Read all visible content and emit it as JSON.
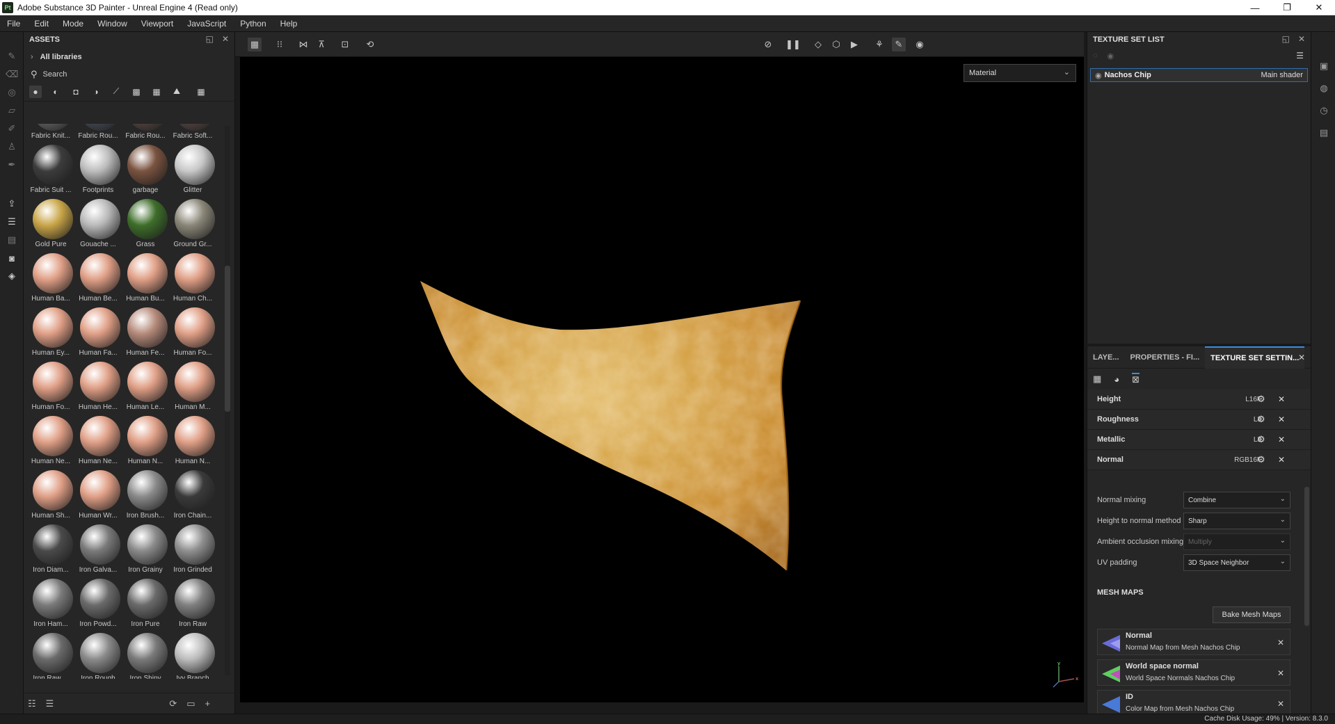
{
  "window": {
    "title": "Adobe Substance 3D Painter - Unreal Engine 4 (Read only)",
    "app_badge": "Pt",
    "minimize": "—",
    "maximize": "❐",
    "close": "✕"
  },
  "menu": [
    "File",
    "Edit",
    "Mode",
    "Window",
    "Viewport",
    "JavaScript",
    "Python",
    "Help"
  ],
  "assets": {
    "title": "ASSETS",
    "library": "All libraries",
    "search_placeholder": "Search",
    "items": [
      {
        "label": "Fabric Knit...",
        "color": "#6a6a6a"
      },
      {
        "label": "Fabric Rou...",
        "color": "#4a4f5a"
      },
      {
        "label": "Fabric Rou...",
        "color": "#5a4a45"
      },
      {
        "label": "Fabric Soft...",
        "color": "#5a4a48"
      },
      {
        "label": "Fabric Suit ...",
        "color": "#3c3c3c"
      },
      {
        "label": "Footprints",
        "color": "#bdbdbd"
      },
      {
        "label": "garbage",
        "color": "#7a5340"
      },
      {
        "label": "Glitter",
        "color": "#c8c8c8"
      },
      {
        "label": "Gold Pure",
        "color": "#c9a548"
      },
      {
        "label": "Gouache ...",
        "color": "#b9b9b9"
      },
      {
        "label": "Grass",
        "color": "#3e6e2a"
      },
      {
        "label": "Ground Gr...",
        "color": "#8a8678"
      },
      {
        "label": "Human Ba...",
        "color": "#e09f86"
      },
      {
        "label": "Human Be...",
        "color": "#e09f86"
      },
      {
        "label": "Human Bu...",
        "color": "#e09f86"
      },
      {
        "label": "Human Ch...",
        "color": "#e09f86"
      },
      {
        "label": "Human Ey...",
        "color": "#e09f86"
      },
      {
        "label": "Human Fa...",
        "color": "#e09f86"
      },
      {
        "label": "Human Fe...",
        "color": "#b58a7a"
      },
      {
        "label": "Human Fo...",
        "color": "#e09f86"
      },
      {
        "label": "Human Fo...",
        "color": "#e09f86"
      },
      {
        "label": "Human He...",
        "color": "#e09f86"
      },
      {
        "label": "Human Le...",
        "color": "#e09f86"
      },
      {
        "label": "Human M...",
        "color": "#e09f86"
      },
      {
        "label": "Human Ne...",
        "color": "#e09f86"
      },
      {
        "label": "Human Ne...",
        "color": "#e09f86"
      },
      {
        "label": "Human N...",
        "color": "#e09f86"
      },
      {
        "label": "Human N...",
        "color": "#e09f86"
      },
      {
        "label": "Human Sh...",
        "color": "#e09f86"
      },
      {
        "label": "Human Wr...",
        "color": "#e09f86"
      },
      {
        "label": "Iron Brush...",
        "color": "#8a8a8a"
      },
      {
        "label": "Iron Chain...",
        "color": "#3a3a3a"
      },
      {
        "label": "Iron Diam...",
        "color": "#4a4a4a"
      },
      {
        "label": "Iron Galva...",
        "color": "#7a7a7a"
      },
      {
        "label": "Iron Grainy",
        "color": "#8a8a8a"
      },
      {
        "label": "Iron Grinded",
        "color": "#8f8f8f"
      },
      {
        "label": "Iron Ham...",
        "color": "#7a7a7a"
      },
      {
        "label": "Iron Powd...",
        "color": "#6a6a6a"
      },
      {
        "label": "Iron Pure",
        "color": "#6a6a6a"
      },
      {
        "label": "Iron Raw",
        "color": "#808080"
      },
      {
        "label": "Iron Raw ...",
        "color": "#6a6a6a"
      },
      {
        "label": "Iron Rough",
        "color": "#8a8a8a"
      },
      {
        "label": "Iron Shiny",
        "color": "#7a7a7a"
      },
      {
        "label": "Ivy Branch",
        "color": "#bcbcbc"
      }
    ]
  },
  "viewport": {
    "view_mode": "Material"
  },
  "texture_set_list": {
    "title": "TEXTURE SET LIST",
    "item": "Nachos Chip",
    "shader": "Main shader"
  },
  "properties": {
    "tabs": [
      "LAYE...",
      "PROPERTIES - FI...",
      "TEXTURE SET SETTIN..."
    ],
    "channels": [
      {
        "name": "Height",
        "format": "L16F"
      },
      {
        "name": "Roughness",
        "format": "L8"
      },
      {
        "name": "Metallic",
        "format": "L8"
      },
      {
        "name": "Normal",
        "format": "RGB16F"
      }
    ],
    "normal_mixing_label": "Normal mixing",
    "normal_mixing_value": "Combine",
    "height_to_normal_label": "Height to normal method",
    "height_to_normal_value": "Sharp",
    "ao_mixing_label": "Ambient occlusion mixing",
    "ao_mixing_value": "Multiply",
    "uv_padding_label": "UV padding",
    "uv_padding_value": "3D Space Neighbor",
    "mesh_maps_title": "MESH MAPS",
    "bake_button": "Bake Mesh Maps",
    "mesh_maps": [
      {
        "name": "Normal",
        "desc": "Normal Map from Mesh Nachos Chip"
      },
      {
        "name": "World space normal",
        "desc": "World Space Normals Nachos Chip"
      },
      {
        "name": "ID",
        "desc": "Color Map from Mesh Nachos Chip"
      }
    ]
  },
  "status": {
    "text": "Cache Disk Usage:   49% | Version: 8.3.0"
  }
}
